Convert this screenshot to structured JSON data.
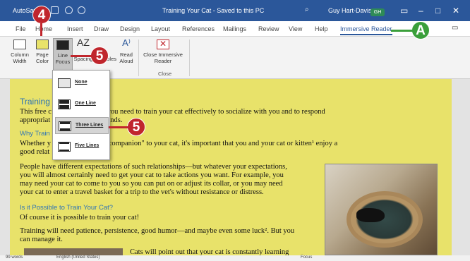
{
  "titlebar": {
    "autosave": "AutoSave",
    "doc_title": "Training Your Cat - Saved to this PC",
    "user": "Guy Hart-Davis",
    "user_initials": "GH"
  },
  "tabs": [
    "File",
    "Home",
    "Insert",
    "Draw",
    "Design",
    "Layout",
    "References",
    "Mailings",
    "Review",
    "View",
    "Help",
    "Immersive Reader"
  ],
  "ribbon": {
    "column_width": [
      "Column",
      "Width"
    ],
    "page_color": [
      "Page",
      "Color"
    ],
    "line_focus": [
      "Line",
      "Focus"
    ],
    "spacing": "Spacing",
    "syllables": "Syllables",
    "read_aloud": [
      "Read",
      "Aloud"
    ],
    "close_reader": [
      "Close Immersive",
      "Reader"
    ],
    "group_close": "Close"
  },
  "dropdown": {
    "items": [
      "None",
      "One Line",
      "Three Lines",
      "Five Lines"
    ],
    "selected": "Three Lines"
  },
  "document": {
    "heading": "Training",
    "l1": "This free c                          ll the information you need to train your cat effectively to socialize with you and to respond",
    "l2": "appropriat                          co         ly useful commands.",
    "sub1": "Why Train",
    "l3": "Whether y                          f an \"owner\" or a \"companion\" to your cat, it's important that you and your cat or kitten¹ enjoy a",
    "l4": "good relat",
    "p2_1": "People have different expectations of such relationships—but whatever your expectations,",
    "p2_2": "you will almost certainly need to get your cat to take actions you want. For example, you",
    "p2_3": "may need your cat to come to you so you can put on or adjust its collar, or you may need",
    "p2_4": "your cat to enter a travel basket for a trip to the vet's without resistance or distress.",
    "sub2": "Is it Possible to Train Your Cat?",
    "p3": "Of course it is possible to train your cat!",
    "p4_1": "Training will need patience, persistence, good humor—and maybe even some luck². But you",
    "p4_2": "can manage it.",
    "p5": "Cats will point out that your cat is constantly learning"
  },
  "statusbar": {
    "words": "99 words",
    "language": "English (United States)",
    "focus": "Focus"
  },
  "callouts": {
    "c4": "4",
    "c5a": "5",
    "c5b": "5",
    "cA": "A"
  },
  "colors": {
    "title_bar": "#2b579a",
    "page_yellow": "#e8e26a",
    "callout_red": "#c0262d",
    "callout_green": "#3a9f3a"
  }
}
